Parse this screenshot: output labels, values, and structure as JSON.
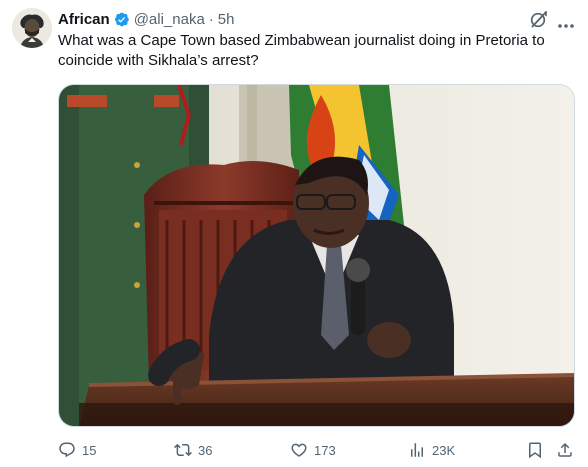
{
  "author": {
    "name": "African",
    "handle": "@ali_naka",
    "separator": "·",
    "time": "5h"
  },
  "tweet": {
    "text": "What was a Cape Town based Zimbabwean journalist doing in Pretoria to coincide with Sikhala’s arrest?"
  },
  "actions": {
    "replies": "15",
    "reposts": "36",
    "likes": "173",
    "views": "23K"
  },
  "icons": {
    "avatar": "avatar-illustration",
    "verified": "verified-badge-icon",
    "grok": "grok-icon",
    "more": "more-icon",
    "reply": "reply-icon",
    "repost": "repost-icon",
    "like": "heart-icon",
    "views": "views-chart-icon",
    "bookmark": "bookmark-icon",
    "share": "share-icon"
  },
  "colors": {
    "text": "#0f1419",
    "secondary": "#536471",
    "verified": "#1d9bf0"
  }
}
